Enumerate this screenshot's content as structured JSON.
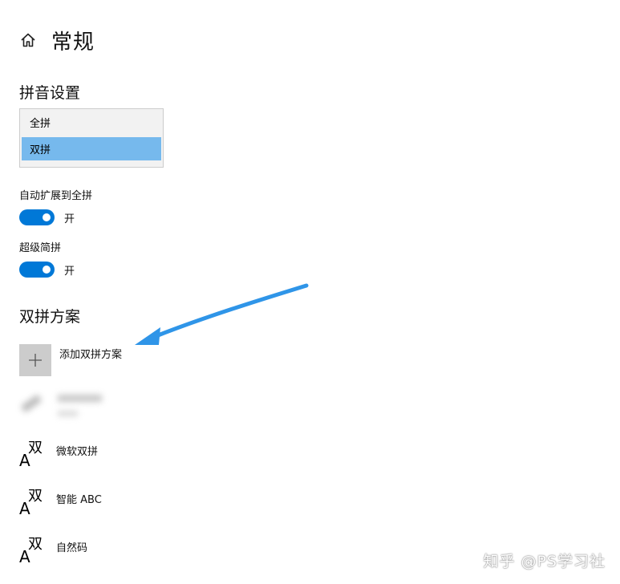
{
  "header": {
    "title": "常规",
    "home_icon": "home-icon"
  },
  "pinyin_settings": {
    "title": "拼音设置",
    "options": [
      "全拼",
      "双拼"
    ],
    "selected": "双拼",
    "selected_color": "#76b9ed"
  },
  "auto_expand": {
    "label": "自动扩展到全拼",
    "state": "开",
    "on": true
  },
  "super_jianpin": {
    "label": "超级简拼",
    "state": "开",
    "on": true
  },
  "shuangpin_schemes": {
    "title": "双拼方案",
    "add_label": "添加双拼方案",
    "add_icon": "plus-icon",
    "items": [
      {
        "label": "微软双拼",
        "icon_main": "A",
        "icon_sub": "双"
      },
      {
        "label": "智能 ABC",
        "icon_main": "A",
        "icon_sub": "双"
      },
      {
        "label": "自然码",
        "icon_main": "A",
        "icon_sub": "双"
      }
    ]
  },
  "toggle_color": "#0078d7",
  "arrow_color": "#2f95e8",
  "watermark": "知乎 @PS学习社"
}
